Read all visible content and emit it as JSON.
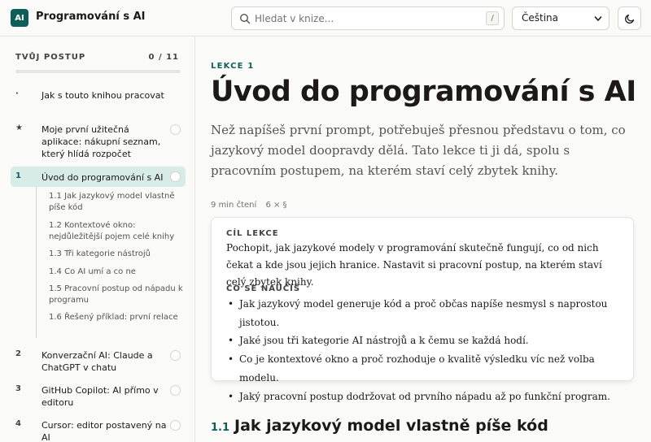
{
  "header": {
    "logo": "AI",
    "title": "Programování s AI",
    "search_placeholder": "Hledat v knize...",
    "search_shortcut": "/",
    "language": "Čeština"
  },
  "sidebar": {
    "progress_label": "TVŮJ POSTUP",
    "progress_count": "0 / 11",
    "progress_fraction": 0,
    "items": [
      {
        "num": "·",
        "label": "Jak s touto knihou pracovat",
        "circle": false
      },
      {
        "num": "★",
        "label": "Moje první užitečná aplikace: nákupní seznam, který hlídá rozpočet",
        "circle": true
      },
      {
        "num": "1",
        "label": "Úvod do programování s AI",
        "circle": true,
        "active": true
      },
      {
        "num": "2",
        "label": "Konverzační AI: Claude a ChatGPT v chatu",
        "circle": true
      },
      {
        "num": "3",
        "label": "GitHub Copilot: AI přímo v editoru",
        "circle": true
      },
      {
        "num": "4",
        "label": "Cursor: editor postavený na AI",
        "circle": true
      }
    ],
    "subitems": [
      "1.1  Jak jazykový model vlastně píše kód",
      "1.2  Kontextové okno: nejdůležitější pojem celé knihy",
      "1.3  Tři kategorie nástrojů",
      "1.4  Co AI umí a co ne",
      "1.5  Pracovní postup od nápadu k programu",
      "1.6  Řešený příklad: první relace"
    ]
  },
  "main": {
    "kicker": "LEKCE 1",
    "title": "Úvod do programování s AI",
    "lead": "Než napíšeš první prompt, potřebuješ přesnou představu o tom, co jazykový model doopravdy dělá. Tato lekce ti ji dá, spolu s pracovním postupem, na kterém staví celý zbytek knihy.",
    "meta_time": "9 min čtení",
    "meta_sections": "6 × §",
    "goal_heading": "CÍL LEKCE",
    "goal_text": "Pochopit, jak jazykové modely v programování skutečně fungují, co od nich čekat a kde jsou jejich hranice. Nastavit si pracovní postup, na kterém staví celý zbytek knihy.",
    "learn_heading": "CO SE NAUČÍŠ",
    "learn_items": [
      "Jak jazykový model generuje kód a proč občas napíše nesmysl s naprostou jistotou.",
      "Jaké jsou tři kategorie AI nástrojů a k čemu se každá hodí.",
      "Co je kontextové okno a proč rozhoduje o kvalitě výsledku víc než volba modelu.",
      "Jaký pracovní postup dodržovat od prvního nápadu až po funkční program."
    ],
    "section_num": "1.1",
    "section_title": "Jak jazykový model vlastně píše kód"
  },
  "colors": {
    "accent": "#0f5e58",
    "active_bg": "#d7ebe7"
  }
}
